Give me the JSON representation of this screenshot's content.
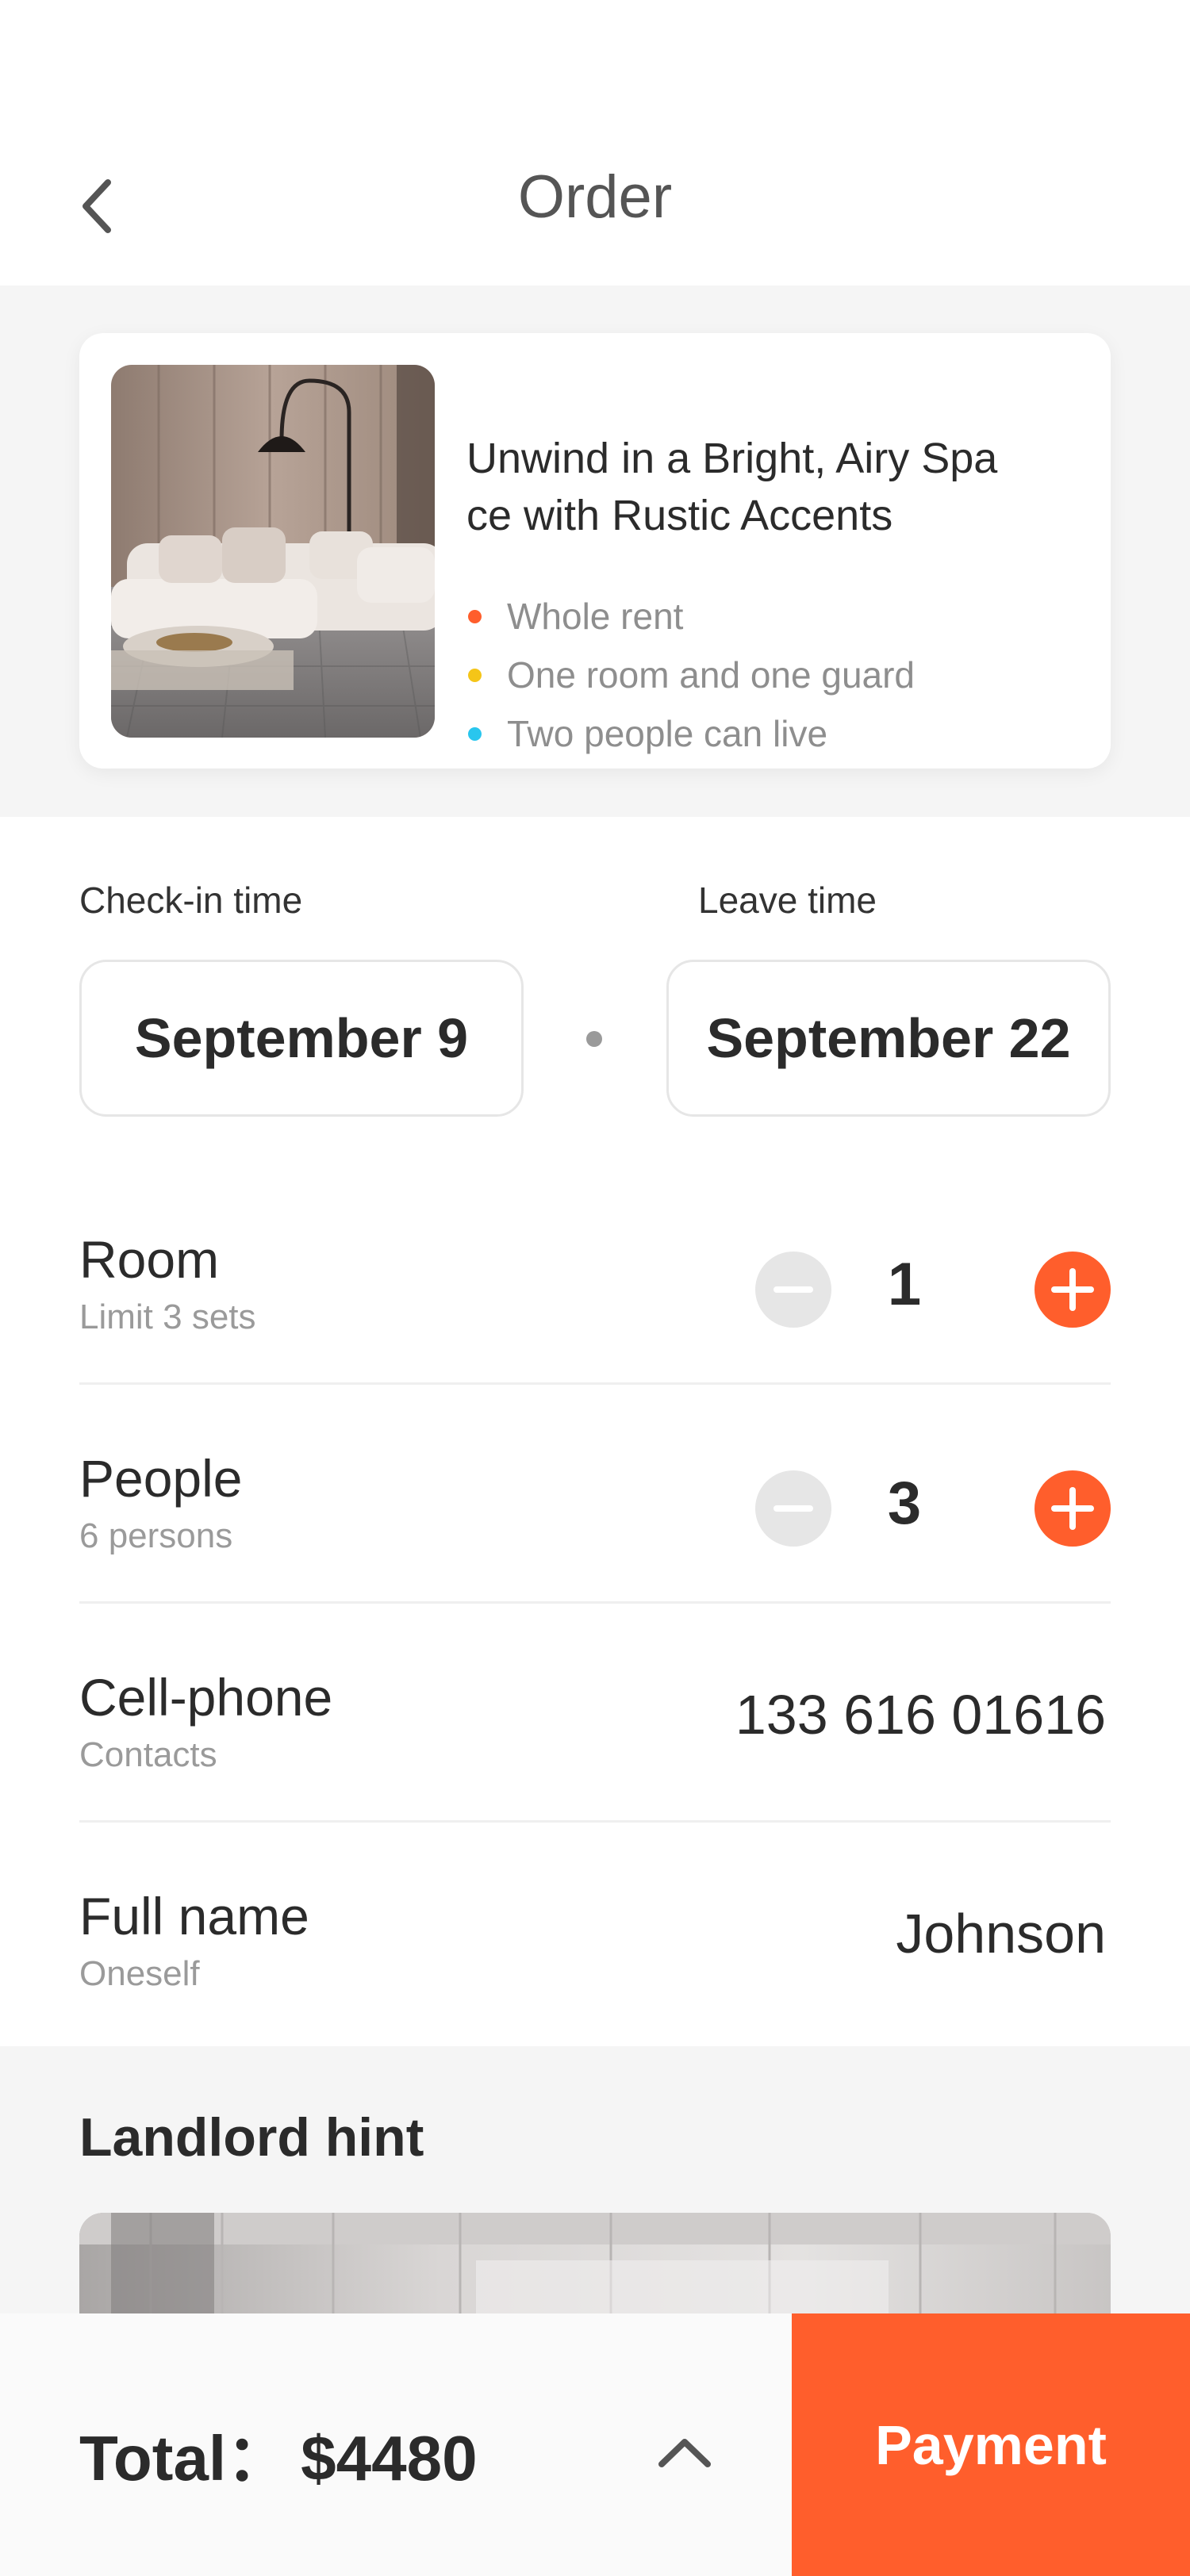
{
  "header": {
    "title": "Order"
  },
  "listing": {
    "title_line1": "Unwind in a Bright, Airy Spa",
    "title_line2": "ce with Rustic Accents",
    "features": [
      {
        "text": "Whole rent",
        "color": "#ff5e2c"
      },
      {
        "text": "One room and one guard",
        "color": "#f5c518"
      },
      {
        "text": "Two people can live",
        "color": "#29c6ee"
      }
    ]
  },
  "dates": {
    "checkin_label": "Check-in time",
    "checkin_value": "September 9",
    "leave_label": "Leave time",
    "leave_value": "September 22"
  },
  "room": {
    "label": "Room",
    "sub": "Limit 3 sets",
    "count": "1"
  },
  "people": {
    "label": "People",
    "sub": "6 persons",
    "count": "3"
  },
  "phone": {
    "label": "Cell-phone",
    "sub": "Contacts",
    "value": "133 616 01616"
  },
  "name": {
    "label": "Full name",
    "sub": "Oneself",
    "value": "Johnson"
  },
  "hint": {
    "title": "Landlord hint"
  },
  "footer": {
    "total_label": "Total：",
    "total_value": "$4480",
    "payment_label": "Payment"
  },
  "colors": {
    "accent": "#ff5e2c",
    "stepper_disabled": "#e6e6e6",
    "background_band": "#f5f5f5"
  }
}
